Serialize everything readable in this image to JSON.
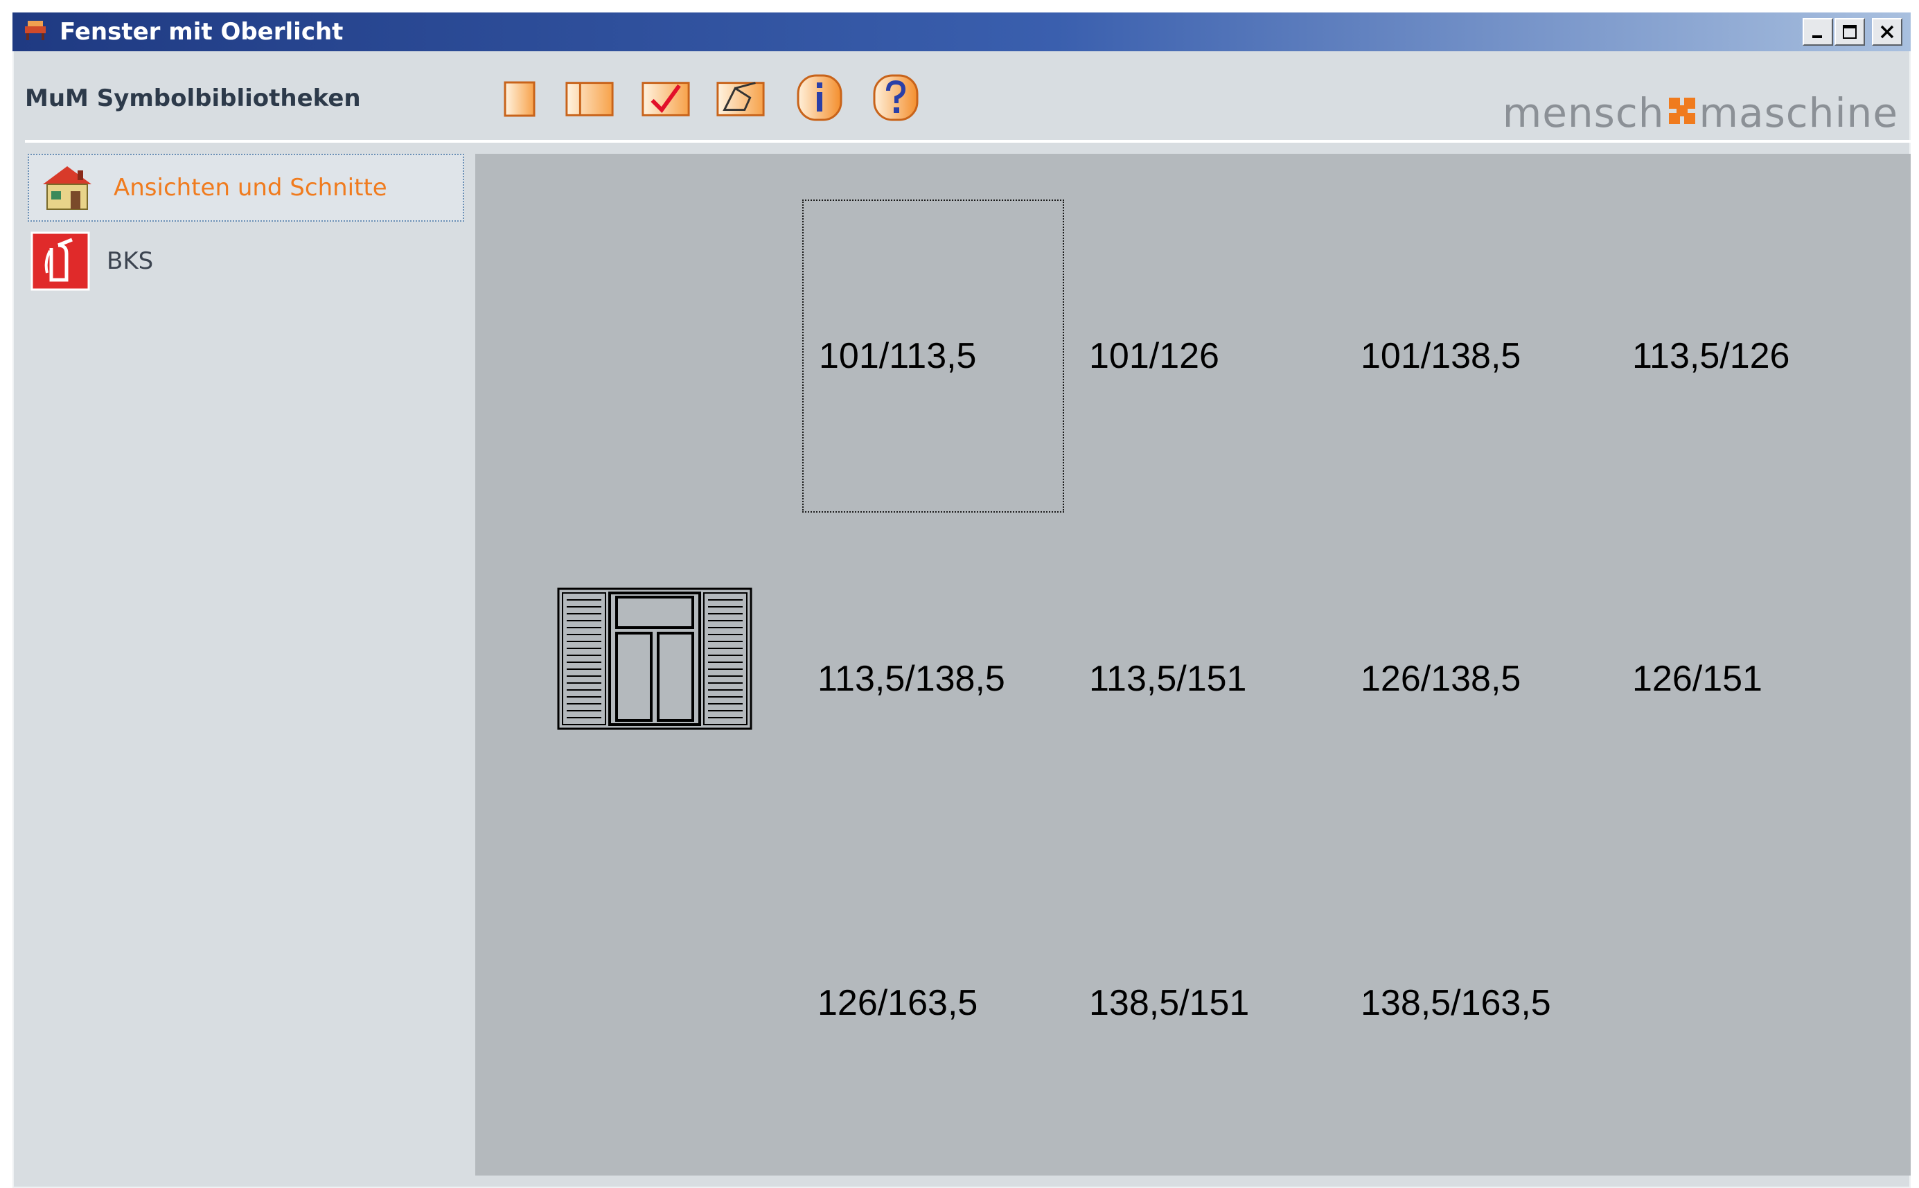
{
  "window": {
    "title": "Fenster mit Oberlicht",
    "icon": "app-furniture-icon",
    "controls": [
      {
        "name": "minimize-button",
        "icon": "minimize-icon"
      },
      {
        "name": "maximize-button",
        "icon": "maximize-icon"
      },
      {
        "name": "close-button",
        "icon": "close-icon"
      }
    ]
  },
  "header": {
    "library_title": "MuM Symbolbibliotheken",
    "toolbar": [
      {
        "name": "toolbar-single-view-button",
        "icon": "square-icon"
      },
      {
        "name": "toolbar-split-view-button",
        "icon": "split-square-icon"
      },
      {
        "name": "toolbar-check-button",
        "icon": "checkmark-icon"
      },
      {
        "name": "toolbar-edit-button",
        "icon": "pencil-shape-icon"
      },
      {
        "name": "toolbar-info-button",
        "icon": "info-icon"
      },
      {
        "name": "toolbar-help-button",
        "icon": "help-icon"
      }
    ],
    "brand": {
      "left": "mensch",
      "right": "maschine",
      "accent": "#f07b1e"
    }
  },
  "sidebar": {
    "items": [
      {
        "label": "Ansichten und Schnitte",
        "icon": "house-icon",
        "selected": true
      },
      {
        "label": "BKS",
        "icon": "fire-extinguisher-icon",
        "selected": false
      }
    ]
  },
  "grid": {
    "items": [
      "101/113,5",
      "101/126",
      "101/138,5",
      "113,5/126",
      "113,5/138,5",
      "113,5/151",
      "126/138,5",
      "126/151",
      "126/163,5",
      "138,5/151",
      "138,5/163,5"
    ],
    "selected_index": 0,
    "preview_icon": "window-with-transom-icon"
  },
  "colors": {
    "content_bg": "#b4b9bd",
    "window_bg": "#d8dde1",
    "selection_text": "#f07b1e"
  }
}
